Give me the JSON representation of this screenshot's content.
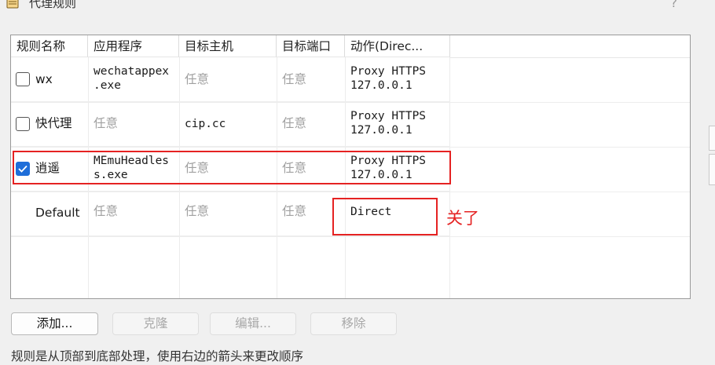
{
  "window": {
    "title": "代理规则",
    "help": "?"
  },
  "table": {
    "columns": [
      "规则名称",
      "应用程序",
      "目标主机",
      "目标端口",
      "动作(Direc..."
    ],
    "rows": [
      {
        "checked": false,
        "name": "wx",
        "app": "wechatappex\n.exe",
        "host": "任意",
        "port": "任意",
        "action": "Proxy HTTPS\n127.0.0.1"
      },
      {
        "checked": false,
        "name": "快代理",
        "app": "任意",
        "host": "cip.cc",
        "port": "任意",
        "action": "Proxy HTTPS\n127.0.0.1"
      },
      {
        "checked": true,
        "name": "逍遥",
        "app": "MEmuHeadles\ns.exe",
        "host": "任意",
        "port": "任意",
        "action": "Proxy HTTPS\n127.0.0.1"
      },
      {
        "name": "Default",
        "app": "任意",
        "host": "任意",
        "port": "任意",
        "action": "Direct"
      }
    ]
  },
  "annotation": {
    "text": "关了",
    "color": "#e52222"
  },
  "buttons": {
    "add": "添加...",
    "clone": "克隆",
    "edit": "编辑...",
    "remove": "移除"
  },
  "footer": "规则是从顶部到底部处理，使用右边的箭头来更改顺序",
  "colors": {
    "accent": "#1e6ed9",
    "highlight": "#e52222"
  }
}
